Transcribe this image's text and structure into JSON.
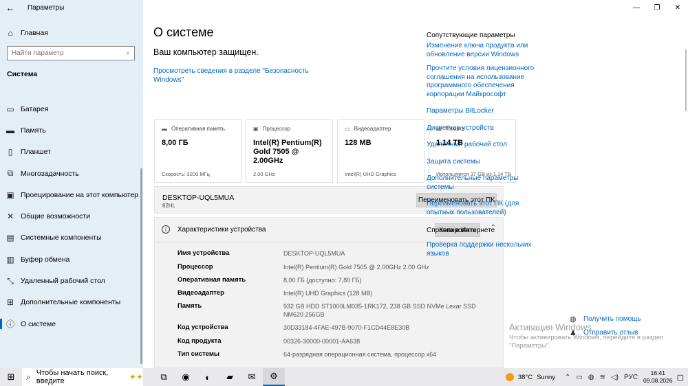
{
  "window": {
    "title": "Параметры",
    "back_glyph": "←",
    "minimize_glyph": "—",
    "maximize_glyph": "❐",
    "close_glyph": "✕"
  },
  "sidebar": {
    "home": {
      "label": "Главная",
      "icon": "home-icon",
      "glyph": "⌂"
    },
    "search": {
      "placeholder": "Найти параметр",
      "glyph": "⌕"
    },
    "section": "Система",
    "items": [
      {
        "label": "Батарея",
        "icon": "battery-icon",
        "glyph": "▭"
      },
      {
        "label": "Память",
        "icon": "storage-icon",
        "glyph": "▬"
      },
      {
        "label": "Планшет",
        "icon": "tablet-icon",
        "glyph": "▯"
      },
      {
        "label": "Многозадачность",
        "icon": "multitasking-icon",
        "glyph": "⧉"
      },
      {
        "label": "Проецирование на этот компьютер",
        "icon": "projecting-icon",
        "glyph": "▣"
      },
      {
        "label": "Общие возможности",
        "icon": "shared-experiences-icon",
        "glyph": "✕"
      },
      {
        "label": "Системные компоненты",
        "icon": "system-components-icon",
        "glyph": "▤"
      },
      {
        "label": "Буфер обмена",
        "icon": "clipboard-icon",
        "glyph": "▥"
      },
      {
        "label": "Удаленный рабочий стол",
        "icon": "remote-desktop-icon",
        "glyph": "⤡"
      },
      {
        "label": "Дополнительные компоненты",
        "icon": "optional-features-icon",
        "glyph": "⊞"
      },
      {
        "label": "О системе",
        "icon": "about-icon",
        "glyph": "ⓘ",
        "active": true
      }
    ]
  },
  "main": {
    "title": "О системе",
    "protected": "Ваш компьютер защищен.",
    "security_link": "Просмотреть сведения в разделе \"Безопасность Windows\"",
    "cards": [
      {
        "name": "Оперативная память",
        "glyph": "▬",
        "value": "8,00 ГБ",
        "foot": "Скорость: 3200 МГц"
      },
      {
        "name": "Процессор",
        "glyph": "▣",
        "value": "Intel(R) Pentium(R) Gold 7505 @ 2.00GHz",
        "foot": "2.00 GHz"
      },
      {
        "name": "Видеоадаптер",
        "glyph": "▭",
        "value": "128 MB",
        "foot": "Intel(R) UHD Graphics"
      },
      {
        "name": "Память",
        "glyph": "▤",
        "value": "1.14 TB",
        "foot": "Используется 37 GB из 1.14 TB"
      }
    ],
    "device": {
      "name": "DESKTOP-UQL5MUA",
      "model": "82HL",
      "rename_label": "Переименовать этот ПК"
    },
    "specs": {
      "title": "Характеристики устройства",
      "copy_label": "Копировать",
      "chevron": "⌃",
      "rows": [
        {
          "label": "Имя устройства",
          "value": "DESKTOP-UQL5MUA"
        },
        {
          "label": "Процессор",
          "value": "Intel(R) Pentium(R) Gold 7505 @ 2.00GHz   2.00 GHz"
        },
        {
          "label": "Оперативная память",
          "value": "8,00 ГБ (доступно: 7,80 ГБ)"
        },
        {
          "label": "Видеоадаптер",
          "value": "Intel(R) UHD Graphics (128 MB)"
        },
        {
          "label": "Память",
          "value": "932 GB HDD ST1000LM035-1RK172, 238 GB SSD NVMe Lexar SSD NM620 256GB"
        },
        {
          "label": "Код устройства",
          "value": "30D33184-4FAE-497B-9070-F1CD44E8E30B"
        },
        {
          "label": "Код продукта",
          "value": "00326-30000-00001-AA638"
        },
        {
          "label": "Тип системы",
          "value": "64-разрядная операционная система, процессор x64"
        }
      ]
    }
  },
  "related": {
    "title": "Сопутствующие параметры",
    "links": [
      "Изменение ключа продукта или обновление версии Windows",
      "Прочтите условия лицензионного соглашения на использование программного обеспечения корпорации Майкрософт",
      "Параметры BitLocker",
      "Диспетчер устройств",
      "Удаленный рабочий стол",
      "Защита системы",
      "Дополнительные параметры системы",
      "Переименовать этот ПК (для опытных пользователей)"
    ],
    "help_title": "Справка в Интернете",
    "help_links": [
      "Проверка поддержки нескольких языков"
    ],
    "get_help": "Получить помощь",
    "feedback": "Отправить отзыв"
  },
  "activation": {
    "title": "Активация Windows",
    "text": "Чтобы активировать Windows, перейдите в раздел \"Параметры\"."
  },
  "taskbar": {
    "start_glyph": "⊞",
    "search_placeholder": "Чтобы начать поиск, введите",
    "search_glyph": "⌕",
    "sparkle": "✦✦",
    "apps": [
      {
        "name": "task-view-icon",
        "glyph": "⧉"
      },
      {
        "name": "copilot-icon",
        "glyph": "◉"
      },
      {
        "name": "edge-icon",
        "glyph": "◐"
      },
      {
        "name": "file-explorer-icon",
        "glyph": "▰"
      },
      {
        "name": "outlook-icon",
        "glyph": "✉"
      },
      {
        "name": "settings-icon",
        "glyph": "⚙",
        "active": true
      }
    ],
    "weather_temp": "38°C",
    "weather_text": "Sunny",
    "language": "РУС",
    "time": "16:41",
    "date": "09.08.2026",
    "tray_glyphs": {
      "chevron": "⌃",
      "battery": "▭",
      "network": "◍",
      "wifi": "≋",
      "volume": "◁)",
      "notification": "▢"
    }
  },
  "colors": {
    "sidebar_bg": "#e4eef5",
    "link": "#0067c0",
    "card_border": "#dddddd",
    "panel_bg": "#f2f2f2",
    "button_bg": "#d8d8d8",
    "taskbar_bg": "#e9e9ec"
  }
}
